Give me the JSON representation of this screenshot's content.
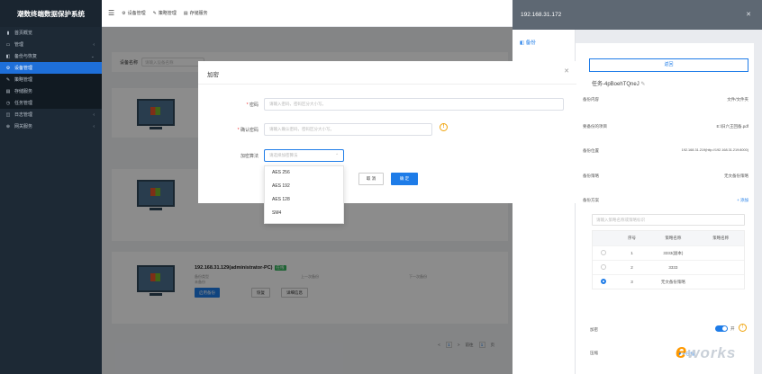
{
  "app": {
    "title": "潮数终端数据保护系统"
  },
  "sidebar": {
    "items": [
      {
        "label": "首页概览",
        "icon": "dashboard-icon"
      },
      {
        "label": "管理",
        "icon": "monitor-icon"
      },
      {
        "label": "备份与恢复",
        "icon": "backup-icon"
      },
      {
        "label": "设备管理",
        "icon": "device-icon"
      },
      {
        "label": "策略管理",
        "icon": "policy-icon"
      },
      {
        "label": "存储服务",
        "icon": "storage-icon"
      },
      {
        "label": "任务管理",
        "icon": "task-icon"
      },
      {
        "label": "日志管理",
        "icon": "log-icon"
      },
      {
        "label": "网关服务",
        "icon": "gateway-icon"
      }
    ]
  },
  "topbar": {
    "tabs": [
      "设备管理",
      "策略管理",
      "存储服务"
    ]
  },
  "filter": {
    "label": "设备名称",
    "placeholder": "请输入设备名称"
  },
  "cards": [
    {
      "host": "192.168.31.129(administrator-PC)",
      "status": "在线",
      "l1": "备份类型",
      "l2": "未备份",
      "last": "上一次备份",
      "next": "下一次备份",
      "btn_enable": "启用备份",
      "btn_restore": "恢复",
      "btn_detail": "详细信息"
    },
    {
      "label": "Windows"
    }
  ],
  "pager": {
    "prev": "<",
    "page": "1",
    "next": ">",
    "goto": "前往",
    "goto_page": "1",
    "unit": "页"
  },
  "modal": {
    "title": "加密",
    "password_label": "密码",
    "password_placeholder": "请输入密码，密码区分大小写。",
    "confirm_label": "确认密码",
    "confirm_placeholder": "请输入确认密码，密码区分大小写。",
    "algo_label": "加密算法",
    "algo_placeholder": "请选择加密算法",
    "cancel": "取 消",
    "ok": "确 定",
    "options": [
      "AES 256",
      "AES 192",
      "AES 128",
      "SM4"
    ]
  },
  "rpanel": {
    "title": "192.168.31.172",
    "tab": "备份",
    "button": "返回",
    "task": "任务-4pBoehTQneJ",
    "rows": [
      {
        "k": "备份内容",
        "v": "文件/文件夹"
      },
      {
        "k": "要备份的项目",
        "v": "E:\\旧六王回备.pdf"
      },
      {
        "k": "备份位置",
        "v": "192.168.31.219(http://192.168.31.219:8000)"
      },
      {
        "k": "备份策略",
        "v": "无文备份策略"
      },
      {
        "k": "备份方案",
        "v": "+ 添加"
      }
    ],
    "search_placeholder": "请输入策略名称或策略标识",
    "table": {
      "headers": [
        "序号",
        "策略名称",
        "策略名称"
      ],
      "rows": [
        {
          "n": "1",
          "name": "3333(副本)"
        },
        {
          "n": "2",
          "name": "3333"
        },
        {
          "n": "3",
          "name": "无文备份策略"
        }
      ]
    },
    "encrypt_label": "加密",
    "toggle_label": "开",
    "compress_label": "压缩",
    "compress_value": "不压缩"
  },
  "watermark": {
    "e": "e",
    "rest": "works"
  }
}
